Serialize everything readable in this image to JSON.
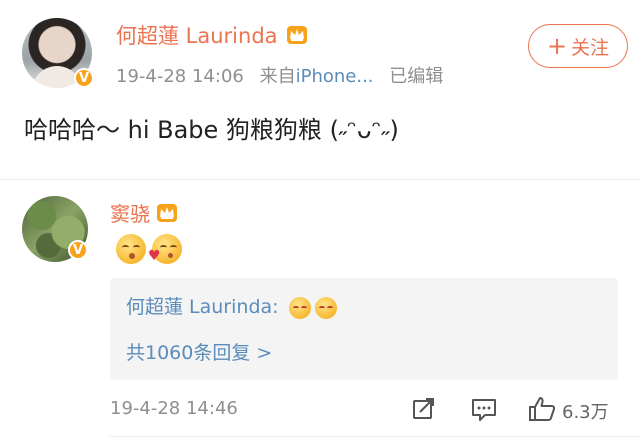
{
  "post": {
    "username": "何超蓮 Laurinda",
    "timestamp": "19-4-28 14:06",
    "source_prefix": "来自",
    "source": "iPhone...",
    "edited": "已编辑",
    "follow_label": "关注",
    "text": "哈哈哈～ hi Babe 狗粮狗粮 (˶ᵔᴗᵔ˶)"
  },
  "comment": {
    "username": "窦骁",
    "reply_preview": {
      "author": "何超蓮 Laurinda:",
      "count_label": "共1060条回复 >"
    },
    "timestamp": "19-4-28 14:46",
    "like_count": "6.3万"
  },
  "colors": {
    "username": "#eb7350",
    "link": "#5b8cbb",
    "meta": "#8f8f8f",
    "badge": "#f7a21b"
  },
  "icons": [
    "crown-icon",
    "verified-badge-icon",
    "share-icon",
    "comment-icon",
    "like-icon",
    "plus-icon"
  ]
}
